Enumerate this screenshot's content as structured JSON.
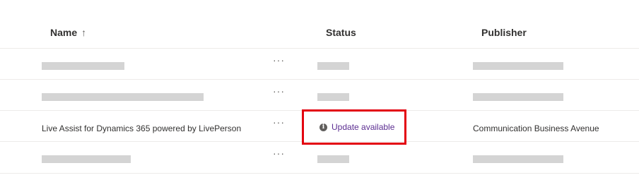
{
  "table": {
    "columns": {
      "name": "Name",
      "status": "Status",
      "publisher": "Publisher"
    },
    "sort_indicator": "↑",
    "more_label": "···",
    "rows": [
      {
        "name": "",
        "status": "",
        "publisher": "",
        "redacted": true
      },
      {
        "name": "",
        "status": "",
        "publisher": "",
        "redacted": true
      },
      {
        "name": "Live Assist for Dynamics 365 powered by LivePerson",
        "status": "Update available",
        "status_icon": "info-icon",
        "publisher": "Communication Business Avenue",
        "redacted": false,
        "highlighted": true
      },
      {
        "name": "",
        "status": "",
        "publisher": "",
        "redacted": true
      }
    ]
  },
  "colors": {
    "link": "#5c2e91",
    "highlight": "#e3000f",
    "placeholder": "#d4d4d4"
  }
}
